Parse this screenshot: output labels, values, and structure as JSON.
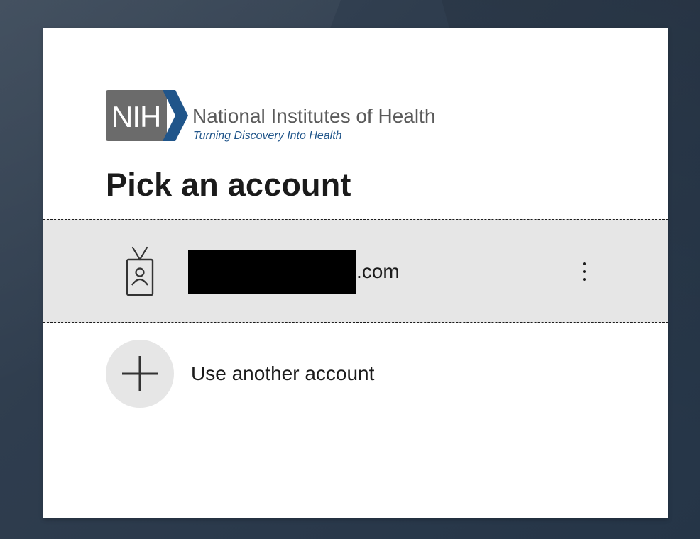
{
  "logo": {
    "mark": "NIH",
    "name": "National Institutes of Health",
    "tagline": "Turning Discovery Into Health",
    "colors": {
      "mark_bg": "#6b6b6b",
      "chevron": "#20558a",
      "name_text": "#5a5a5a",
      "tagline_text": "#20558a"
    }
  },
  "heading": "Pick an account",
  "accounts": [
    {
      "icon": "id-badge-icon",
      "email_suffix": ".com",
      "email_redacted": true,
      "more_icon": "more-vertical-icon"
    }
  ],
  "use_another": {
    "icon": "plus-icon",
    "label": "Use another account"
  },
  "colors": {
    "row_highlight": "#e6e6e6",
    "text": "#1b1b1b",
    "card_bg": "#ffffff"
  }
}
